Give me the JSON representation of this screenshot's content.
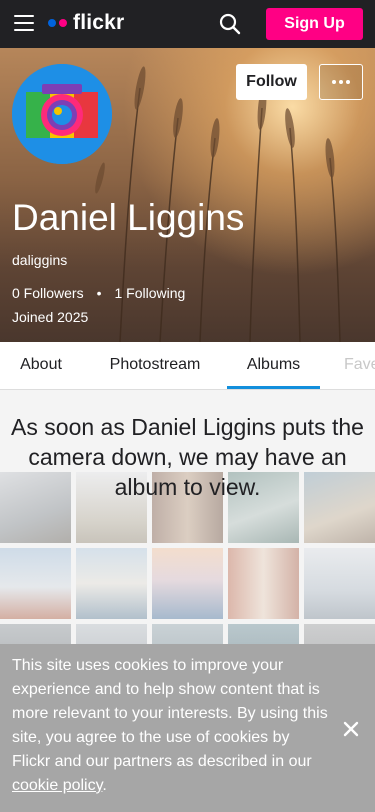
{
  "header": {
    "logo_text": "flickr",
    "logo_dot_colors": [
      "#0063dc",
      "#ff0084"
    ],
    "signup_label": "Sign Up",
    "icons": [
      "menu-icon",
      "search-icon"
    ]
  },
  "profile": {
    "name": "Daniel Liggins",
    "username": "daliggins",
    "followers": "0 Followers",
    "following": "1 Following",
    "joined": "Joined 2025",
    "follow_label": "Follow",
    "more_icon": "more-dots-icon"
  },
  "tabs": [
    {
      "label": "About",
      "active": false
    },
    {
      "label": "Photostream",
      "active": false
    },
    {
      "label": "Albums",
      "active": true
    },
    {
      "label": "Faves",
      "active": false
    }
  ],
  "albums": {
    "empty_message": "As soon as Daniel Liggins puts the camera down, we may have an album to view."
  },
  "cookie_banner": {
    "text": "This site uses cookies to improve your experience and to help show content that is more relevant to your interests. By using this site, you agree to the use of cookies by Flickr and our partners as described in our ",
    "link_text": "cookie policy",
    "trailing": ".",
    "close_icon": "close-icon"
  },
  "colors": {
    "brand_pink": "#ff0084",
    "brand_blue": "#0063dc",
    "tab_active": "#128fdc",
    "topbar": "#212124"
  }
}
